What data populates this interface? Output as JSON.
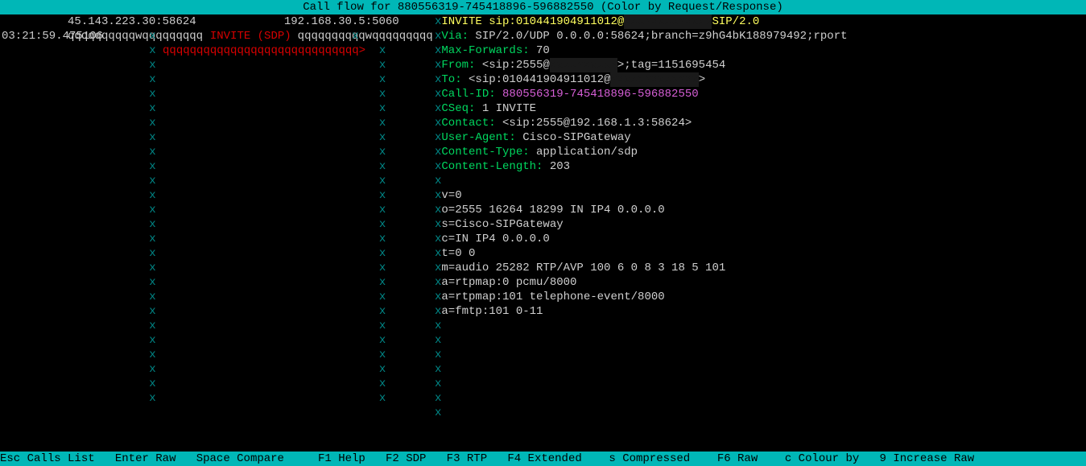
{
  "title": "Call flow for 880556319-745418896-596882550 (Color by Request/Response)",
  "endpoints": {
    "left": "45.143.223.30:58624",
    "right": "192.168.30.5:5060",
    "ql": "qqqqqqqqqqwqqqqqqqqq",
    "qr": "qqqqqqqqqqwqqqqqqqqq"
  },
  "flow": {
    "timestamp": "03:21:59.475106",
    "label": "INVITE (SDP)",
    "arrow": "qqqqqqqqqqqqqqqqqqqqqqqqqqqqq>"
  },
  "x": "x",
  "sip": {
    "request_line_pre": "INVITE sip:010441904911012@",
    "request_line_post": "SIP/2.0",
    "via_h": "Via:",
    "via_v": " SIP/2.0/UDP 0.0.0.0:58624;branch=z9hG4bK188979492;rport",
    "maxf_h": "Max-Forwards:",
    "maxf_v": " 70",
    "from_h": "From:",
    "from_v_pre": " <sip:2555@",
    "from_v_post": ">;tag=1151695454",
    "to_h": "To:",
    "to_v_pre": " <sip:010441904911012@",
    "to_v_post": ">",
    "callid_h": "Call-ID:",
    "callid_v": " 880556319-745418896-596882550",
    "cseq_h": "CSeq:",
    "cseq_v": " 1 INVITE",
    "contact_h": "Contact:",
    "contact_v": " <sip:2555@192.168.1.3:58624>",
    "ua_h": "User-Agent:",
    "ua_v": " Cisco-SIPGateway",
    "ct_h": "Content-Type:",
    "ct_v": " application/sdp",
    "cl_h": "Content-Length:",
    "cl_v": " 203",
    "sdp": [
      "v=0",
      "o=2555 16264 18299 IN IP4 0.0.0.0",
      "s=Cisco-SIPGateway",
      "c=IN IP4 0.0.0.0",
      "t=0 0",
      "m=audio 25282 RTP/AVP 100 6 0 8 3 18 5 101",
      "a=rtpmap:0 pcmu/8000",
      "a=rtpmap:101 telephone-event/8000",
      "a=fmtp:101 0-11"
    ]
  },
  "footer": {
    "esc": "Esc",
    "esc_l": "Calls List",
    "enter": "Enter",
    "enter_l": "Raw",
    "space": "Space",
    "space_l": "Compare",
    "f1": "F1",
    "f1_l": "Help",
    "f2": "F2",
    "f2_l": "SDP",
    "f3": "F3",
    "f3_l": "RTP",
    "f4": "F4",
    "f4_l": "Extended",
    "s": "s",
    "s_l": "Compressed",
    "f6": "F6",
    "f6_l": "Raw",
    "c": "c",
    "c_l": "Colour by",
    "n9": "9",
    "n9_l": "Increase Raw"
  }
}
